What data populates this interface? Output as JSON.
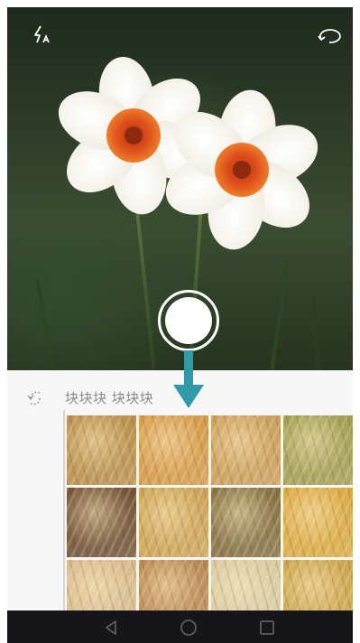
{
  "camera": {
    "flash_icon": "flash-auto-icon",
    "switch_icon": "switch-camera-icon",
    "shutter_icon": "shutter-button"
  },
  "gallery": {
    "back_icon": "back-arrow-icon",
    "search_query": "块块块 块块块",
    "thumbnails": [
      {
        "name": "wheat-spikes-closeup",
        "color": "#b58a45"
      },
      {
        "name": "wheat-field-sunset",
        "color": "#d49640"
      },
      {
        "name": "wheat-ears-on-sky",
        "color": "#c99a55"
      },
      {
        "name": "green-field-trees",
        "color": "#9d9a4c"
      },
      {
        "name": "bread-and-wheat",
        "color": "#6b4a2e"
      },
      {
        "name": "golden-grain-texture",
        "color": "#caa04e"
      },
      {
        "name": "wheat-stalks-dark",
        "color": "#7f6a3a"
      },
      {
        "name": "wheat-field-bright",
        "color": "#d9a63a"
      },
      {
        "name": "wheat-bundle-light",
        "color": "#d7b98a"
      },
      {
        "name": "bread-rolls-wheat",
        "color": "#b8834c"
      },
      {
        "name": "wheat-stems-pale",
        "color": "#d8c9a0"
      },
      {
        "name": "wheat-spike-single",
        "color": "#c9a246"
      }
    ]
  },
  "navigation": {
    "back_icon": "nav-back-icon",
    "home_icon": "nav-home-icon",
    "recents_icon": "nav-recents-icon"
  },
  "colors": {
    "accent_arrow": "#2f9aa8",
    "nav_bar": "#16161a",
    "panel_bg": "#f7f7f7"
  }
}
